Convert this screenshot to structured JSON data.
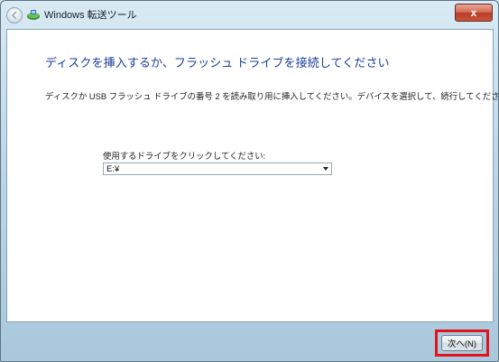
{
  "window": {
    "title": "Windows 転送ツール",
    "close_glyph": "x"
  },
  "main": {
    "heading": "ディスクを挿入するか、フラッシュ ドライブを接続してください",
    "description": "ディスクか USB フラッシュ ドライブの番号 2 を読み取り用に挿入してください。デバイスを選択して、続行してください。",
    "drive_label": "使用するドライブをクリックしてください:",
    "drive_selected": "E:¥"
  },
  "footer": {
    "next_label": "次へ(N)"
  },
  "colors": {
    "heading": "#1a3e9a",
    "highlight": "#e2141b",
    "close": "#c9563f"
  },
  "icons": [
    "back-arrow-icon",
    "transfer-icon",
    "close-icon",
    "dropdown-arrow-icon"
  ]
}
